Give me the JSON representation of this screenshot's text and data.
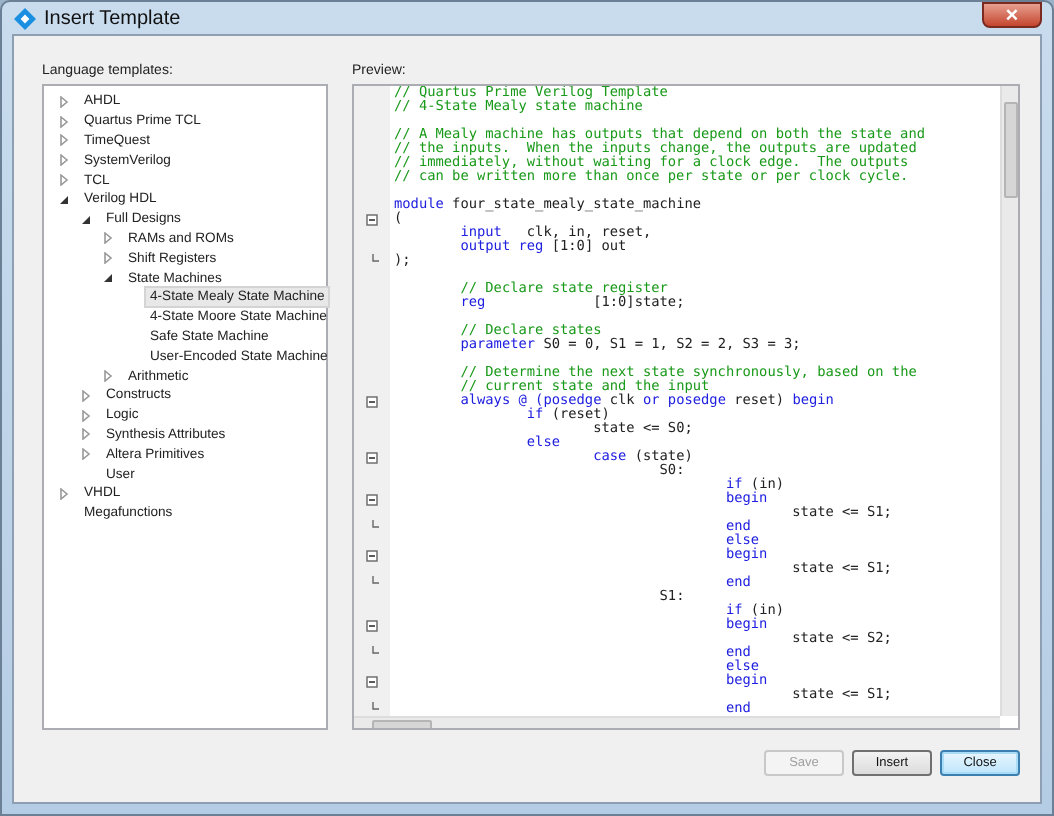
{
  "window": {
    "title": "Insert Template",
    "close": "×"
  },
  "templates": {
    "label": "Language templates:",
    "items": [
      {
        "label": "AHDL",
        "expanded": false,
        "selected": false
      },
      {
        "label": "Quartus Prime TCL",
        "expanded": false,
        "selected": false
      },
      {
        "label": "TimeQuest",
        "expanded": false,
        "selected": false
      },
      {
        "label": "SystemVerilog",
        "expanded": false,
        "selected": false
      },
      {
        "label": "TCL",
        "expanded": false,
        "selected": false
      },
      {
        "label": "Verilog HDL",
        "expanded": true,
        "selected": false,
        "children": [
          {
            "label": "Full Designs",
            "expanded": true,
            "selected": false,
            "children": [
              {
                "label": "RAMs and ROMs",
                "expanded": false,
                "selected": false
              },
              {
                "label": "Shift Registers",
                "expanded": false,
                "selected": false
              },
              {
                "label": "State Machines",
                "expanded": true,
                "selected": false,
                "children": [
                  {
                    "label": "4-State Mealy State Machine",
                    "selected": true
                  },
                  {
                    "label": "4-State Moore State Machine",
                    "selected": false
                  },
                  {
                    "label": "Safe State Machine",
                    "selected": false
                  },
                  {
                    "label": "User-Encoded State Machine",
                    "selected": false
                  }
                ]
              },
              {
                "label": "Arithmetic",
                "expanded": false,
                "selected": false
              }
            ]
          },
          {
            "label": "Constructs",
            "expanded": false,
            "selected": false
          },
          {
            "label": "Logic",
            "expanded": false,
            "selected": false
          },
          {
            "label": "Synthesis Attributes",
            "expanded": false,
            "selected": false
          },
          {
            "label": "Altera Primitives",
            "expanded": false,
            "selected": false
          },
          {
            "label": "User",
            "selected": false
          }
        ]
      },
      {
        "label": "VHDL",
        "expanded": false,
        "selected": false
      },
      {
        "label": "Megafunctions",
        "selected": false
      }
    ]
  },
  "preview": {
    "label": "Preview:",
    "lines": [
      {
        "kind": "comment",
        "text": "// Quartus Prime Verilog Template"
      },
      {
        "kind": "comment",
        "text": "// 4-State Mealy state machine"
      },
      {
        "kind": "blank"
      },
      {
        "kind": "comment",
        "text": "// A Mealy machine has outputs that depend on both the state and"
      },
      {
        "kind": "comment",
        "text": "// the inputs.  When the inputs change, the outputs are updated"
      },
      {
        "kind": "comment",
        "text": "// immediately, without waiting for a clock edge.  The outputs"
      },
      {
        "kind": "comment",
        "text": "// can be written more than once per state or per clock cycle."
      },
      {
        "kind": "blank"
      },
      {
        "kind": "code",
        "tokens": [
          {
            "kind": "keyword",
            "text": "module"
          },
          {
            "kind": "plain",
            "text": " four_state_mealy_state_machine"
          }
        ]
      },
      {
        "kind": "code",
        "expanded": true,
        "tokens": [
          {
            "kind": "plain",
            "text": "("
          }
        ]
      },
      {
        "kind": "code",
        "tokens": [
          {
            "kind": "keyword",
            "text": "\tinput"
          },
          {
            "kind": "plain",
            "text": "\tclk, in, reset,"
          }
        ]
      },
      {
        "kind": "code",
        "tokens": [
          {
            "kind": "keyword",
            "text": "\toutput reg"
          },
          {
            "kind": "plain",
            "text": " [1:0] out"
          }
        ]
      },
      {
        "kind": "code",
        "fold_end": true,
        "tokens": [
          {
            "kind": "plain",
            "text": ");"
          }
        ]
      },
      {
        "kind": "blank"
      },
      {
        "kind": "comment",
        "text": "\t// Declare state register"
      },
      {
        "kind": "code",
        "tokens": [
          {
            "kind": "keyword",
            "text": "\treg"
          },
          {
            "kind": "plain",
            "text": "\t\t[1:0]state;"
          }
        ]
      },
      {
        "kind": "blank"
      },
      {
        "kind": "comment",
        "text": "\t// Declare states"
      },
      {
        "kind": "code",
        "tokens": [
          {
            "kind": "keyword",
            "text": "\tparameter"
          },
          {
            "kind": "plain",
            "text": " S0 = 0, S1 = 1, S2 = 2, S3 = 3;"
          }
        ]
      },
      {
        "kind": "blank"
      },
      {
        "kind": "comment",
        "text": "\t// Determine the next state synchronously, based on the"
      },
      {
        "kind": "comment",
        "text": "\t// current state and the input"
      },
      {
        "kind": "code",
        "expanded": true,
        "tokens": [
          {
            "kind": "keyword",
            "text": "\talways @ (posedge"
          },
          {
            "kind": "plain",
            "text": " clk "
          },
          {
            "kind": "keyword",
            "text": "or posedge"
          },
          {
            "kind": "plain",
            "text": " reset) "
          },
          {
            "kind": "keyword",
            "text": "begin"
          }
        ]
      },
      {
        "kind": "code",
        "tokens": [
          {
            "kind": "keyword",
            "text": "\t\tif"
          },
          {
            "kind": "plain",
            "text": " (reset)"
          }
        ]
      },
      {
        "kind": "code",
        "tokens": [
          {
            "kind": "plain",
            "text": "\t\t\tstate <= S0;"
          }
        ]
      },
      {
        "kind": "code",
        "tokens": [
          {
            "kind": "keyword",
            "text": "\t\telse"
          }
        ]
      },
      {
        "kind": "code",
        "expanded": true,
        "tokens": [
          {
            "kind": "keyword",
            "text": "\t\t\tcase"
          },
          {
            "kind": "plain",
            "text": " (state)"
          }
        ]
      },
      {
        "kind": "code",
        "tokens": [
          {
            "kind": "plain",
            "text": "\t\t\t\tS0:"
          }
        ]
      },
      {
        "kind": "code",
        "tokens": [
          {
            "kind": "keyword",
            "text": "\t\t\t\t\tif"
          },
          {
            "kind": "plain",
            "text": " (in)"
          }
        ]
      },
      {
        "kind": "code",
        "expanded": true,
        "tokens": [
          {
            "kind": "keyword",
            "text": "\t\t\t\t\tbegin"
          }
        ]
      },
      {
        "kind": "code",
        "tokens": [
          {
            "kind": "plain",
            "text": "\t\t\t\t\t\tstate <= S1;"
          }
        ]
      },
      {
        "kind": "code",
        "fold_end": true,
        "tokens": [
          {
            "kind": "keyword",
            "text": "\t\t\t\t\tend"
          }
        ]
      },
      {
        "kind": "code",
        "tokens": [
          {
            "kind": "keyword",
            "text": "\t\t\t\t\telse"
          }
        ]
      },
      {
        "kind": "code",
        "expanded": true,
        "tokens": [
          {
            "kind": "keyword",
            "text": "\t\t\t\t\tbegin"
          }
        ]
      },
      {
        "kind": "code",
        "tokens": [
          {
            "kind": "plain",
            "text": "\t\t\t\t\t\tstate <= S1;"
          }
        ]
      },
      {
        "kind": "code",
        "fold_end": true,
        "tokens": [
          {
            "kind": "keyword",
            "text": "\t\t\t\t\tend"
          }
        ]
      },
      {
        "kind": "code",
        "tokens": [
          {
            "kind": "plain",
            "text": "\t\t\t\tS1:"
          }
        ]
      },
      {
        "kind": "code",
        "tokens": [
          {
            "kind": "keyword",
            "text": "\t\t\t\t\tif"
          },
          {
            "kind": "plain",
            "text": " (in)"
          }
        ]
      },
      {
        "kind": "code",
        "expanded": true,
        "tokens": [
          {
            "kind": "keyword",
            "text": "\t\t\t\t\tbegin"
          }
        ]
      },
      {
        "kind": "code",
        "tokens": [
          {
            "kind": "plain",
            "text": "\t\t\t\t\t\tstate <= S2;"
          }
        ]
      },
      {
        "kind": "code",
        "fold_end": true,
        "tokens": [
          {
            "kind": "keyword",
            "text": "\t\t\t\t\tend"
          }
        ]
      },
      {
        "kind": "code",
        "tokens": [
          {
            "kind": "keyword",
            "text": "\t\t\t\t\telse"
          }
        ]
      },
      {
        "kind": "code",
        "expanded": true,
        "tokens": [
          {
            "kind": "keyword",
            "text": "\t\t\t\t\tbegin"
          }
        ]
      },
      {
        "kind": "code",
        "tokens": [
          {
            "kind": "plain",
            "text": "\t\t\t\t\t\tstate <= S1;"
          }
        ]
      },
      {
        "kind": "code",
        "fold_end": true,
        "tokens": [
          {
            "kind": "keyword",
            "text": "\t\t\t\t\tend"
          }
        ]
      }
    ]
  },
  "buttons": [
    {
      "label": "Save",
      "disabled": true,
      "selected": false
    },
    {
      "label": "Insert",
      "disabled": false,
      "selected": false
    },
    {
      "label": "Close",
      "disabled": false,
      "selected": true
    }
  ]
}
